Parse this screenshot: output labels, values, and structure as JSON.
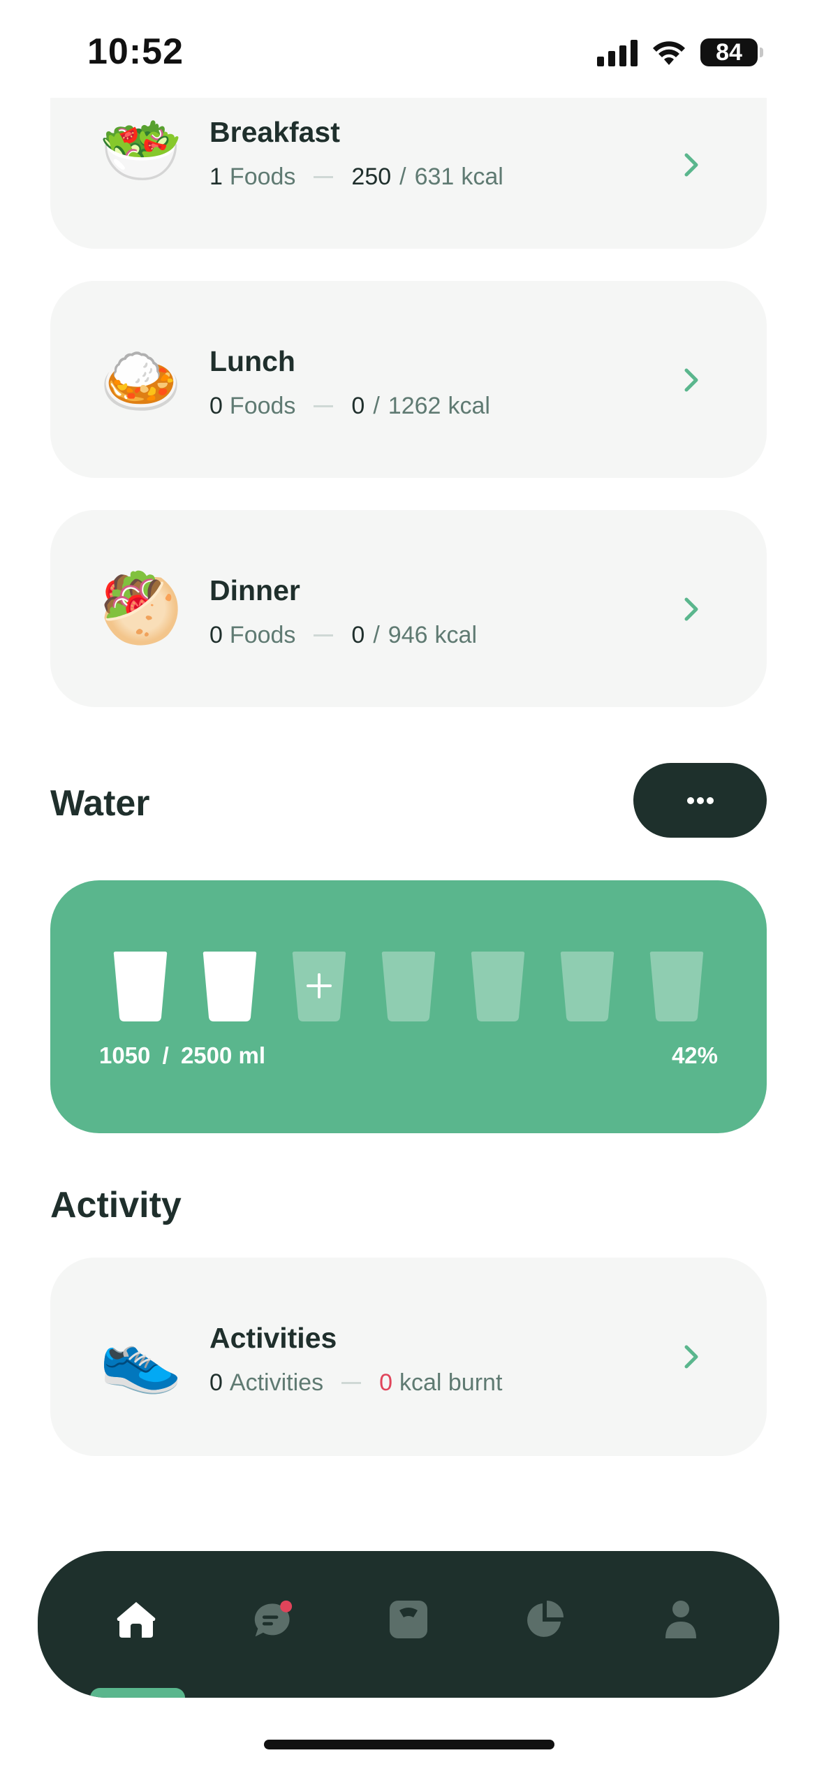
{
  "status_bar": {
    "time": "10:52",
    "battery": "84"
  },
  "meals": [
    {
      "name": "Breakfast",
      "emoji": "🥗",
      "icon": "salad-icon",
      "foods_count": "1",
      "foods_label": "Foods",
      "kcal_eaten": "250",
      "kcal_goal": "631",
      "kcal_unit": "kcal"
    },
    {
      "name": "Lunch",
      "emoji": "🍛",
      "icon": "curry-rice-icon",
      "foods_count": "0",
      "foods_label": "Foods",
      "kcal_eaten": "0",
      "kcal_goal": "1262",
      "kcal_unit": "kcal"
    },
    {
      "name": "Dinner",
      "emoji": "🥙",
      "icon": "stuffed-flatbread-icon",
      "foods_count": "0",
      "foods_label": "Foods",
      "kcal_eaten": "0",
      "kcal_goal": "946",
      "kcal_unit": "kcal"
    }
  ],
  "water": {
    "title": "Water",
    "more_icon": "ellipsis-icon",
    "consumed_ml": "1050",
    "goal_ml": "2500",
    "unit": "ml",
    "percent": "42%",
    "cups_total": 7,
    "cups_filled": 2,
    "add_cup_index": 2
  },
  "activity": {
    "title": "Activity",
    "card_title": "Activities",
    "emoji": "👟",
    "icon": "sneaker-icon",
    "count": "0",
    "count_label": "Activities",
    "kcal_burnt": "0",
    "kcal_label": "kcal burnt"
  },
  "nav": {
    "items": [
      "home-icon",
      "chat-icon",
      "scale-icon",
      "pie-chart-icon",
      "profile-icon"
    ],
    "active": "home-icon",
    "notification_dot_on": "chat-icon"
  },
  "colors": {
    "accent_green": "#5ab68d",
    "dark": "#1e302c",
    "card_bg": "#f5f6f5",
    "muted_text": "#5f7a72",
    "alert_red": "#e0445a"
  }
}
